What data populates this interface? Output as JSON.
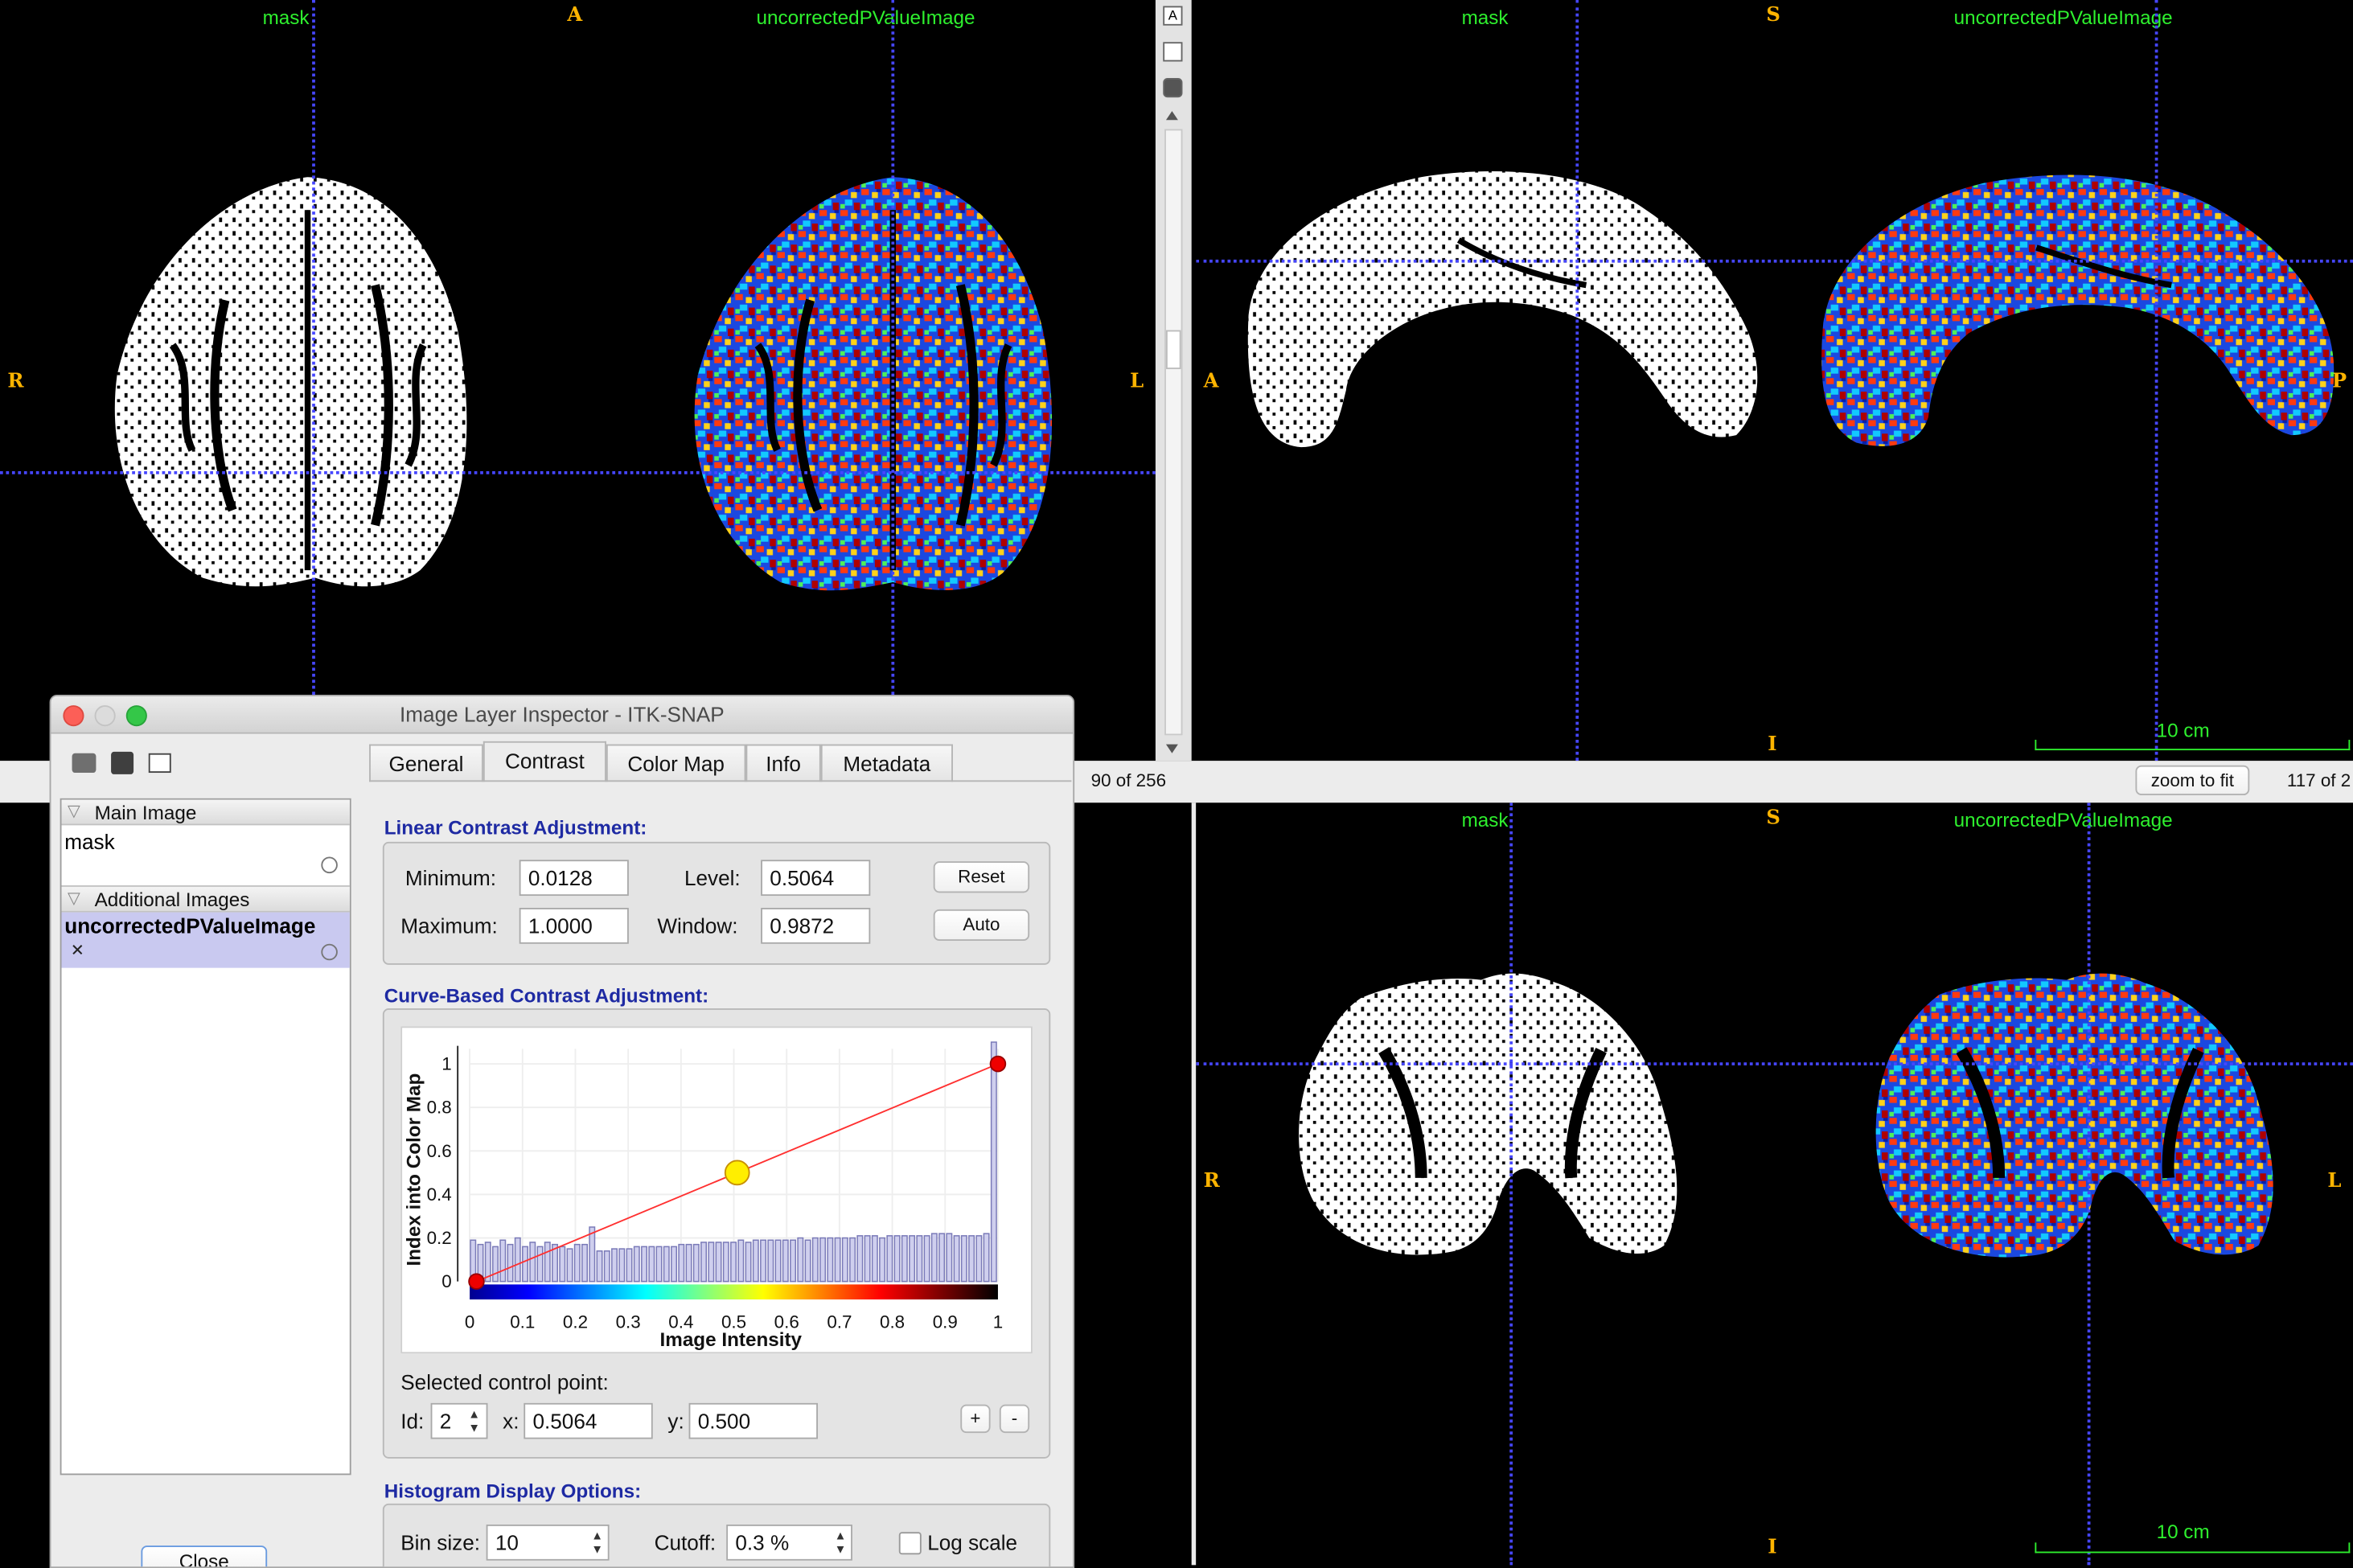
{
  "views": {
    "axial": {
      "label_left": "mask",
      "label_right": "uncorrectedPValueImage",
      "orient_top": "A",
      "orient_left": "R",
      "orient_right": "L",
      "slice_info": "90 of 256"
    },
    "sagittal": {
      "label_left": "mask",
      "label_right": "uncorrectedPValueImage",
      "orient_top": "S",
      "orient_left": "A",
      "orient_right": "P",
      "orient_bottom": "I",
      "scale_text": "10 cm",
      "zoom_button": "zoom to fit",
      "slice_info": "117 of 2"
    },
    "coronal": {
      "label_left": "mask",
      "label_right": "uncorrectedPValueImage",
      "orient_top": "S",
      "orient_left": "R",
      "orient_right": "L",
      "orient_bottom": "I",
      "scale_text": "10 cm"
    }
  },
  "dialog": {
    "title": "Image Layer Inspector - ITK-SNAP",
    "tabs": [
      "General",
      "Contrast",
      "Color Map",
      "Info",
      "Metadata"
    ],
    "active_tab": "Contrast",
    "layers": {
      "main_header": "Main Image",
      "main_item": "mask",
      "additional_header": "Additional Images",
      "additional_item": "uncorrectedPValueImage"
    },
    "close_button": "Close",
    "linear": {
      "title": "Linear Contrast Adjustment:",
      "min_label": "Minimum:",
      "min_value": "0.0128",
      "max_label": "Maximum:",
      "max_value": "1.0000",
      "level_label": "Level:",
      "level_value": "0.5064",
      "window_label": "Window:",
      "window_value": "0.9872",
      "reset_button": "Reset",
      "auto_button": "Auto"
    },
    "curve": {
      "title": "Curve-Based Contrast Adjustment:",
      "selected_label": "Selected control point:",
      "id_label": "Id:",
      "id_value": "2",
      "x_label": "x:",
      "x_value": "0.5064",
      "y_label": "y:",
      "y_value": "0.500",
      "plus_button": "+",
      "minus_button": "-"
    },
    "histogram": {
      "title": "Histogram Display Options:",
      "bin_label": "Bin size:",
      "bin_value": "10",
      "cutoff_label": "Cutoff:",
      "cutoff_value": "0.3 %",
      "log_label": "Log scale"
    }
  },
  "chart_data": {
    "type": "line",
    "xlabel": "Image Intensity",
    "ylabel": "Index into Color Map",
    "xlim": [
      0,
      1
    ],
    "ylim": [
      0,
      1
    ],
    "x_ticks": [
      "0",
      "0.1",
      "0.2",
      "0.3",
      "0.4",
      "0.5",
      "0.6",
      "0.7",
      "0.8",
      "0.9",
      "1"
    ],
    "y_ticks": [
      "0",
      "0.2",
      "0.4",
      "0.6",
      "0.8",
      "1"
    ],
    "control_points": [
      {
        "x": 0.0128,
        "y": 0
      },
      {
        "x": 0.5064,
        "y": 0.5
      },
      {
        "x": 1.0,
        "y": 1
      }
    ],
    "histogram_bins": [
      0.19,
      0.17,
      0.18,
      0.16,
      0.19,
      0.17,
      0.2,
      0.16,
      0.18,
      0.16,
      0.18,
      0.17,
      0.16,
      0.15,
      0.17,
      0.17,
      0.25,
      0.14,
      0.14,
      0.15,
      0.15,
      0.15,
      0.16,
      0.16,
      0.16,
      0.16,
      0.16,
      0.16,
      0.17,
      0.17,
      0.17,
      0.18,
      0.18,
      0.18,
      0.18,
      0.18,
      0.19,
      0.18,
      0.19,
      0.19,
      0.19,
      0.19,
      0.19,
      0.19,
      0.2,
      0.19,
      0.2,
      0.2,
      0.2,
      0.2,
      0.2,
      0.2,
      0.21,
      0.21,
      0.21,
      0.2,
      0.21,
      0.21,
      0.21,
      0.21,
      0.21,
      0.21,
      0.22,
      0.22,
      0.22,
      0.21,
      0.21,
      0.21,
      0.21,
      0.22,
      1.1
    ],
    "colorbar": "jet"
  }
}
